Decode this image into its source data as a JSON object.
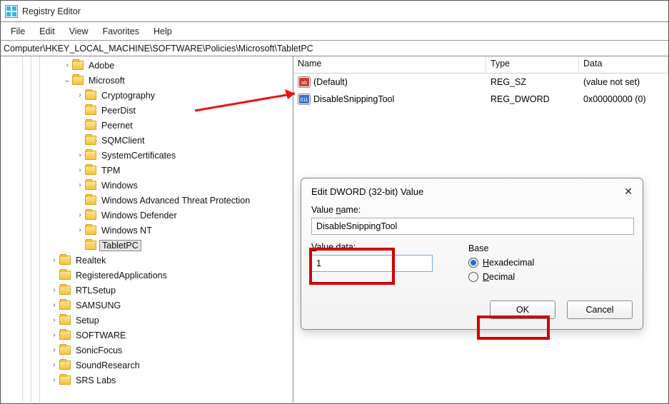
{
  "window": {
    "title": "Registry Editor"
  },
  "menu": {
    "file": "File",
    "edit": "Edit",
    "view": "View",
    "favorites": "Favorites",
    "help": "Help"
  },
  "address": {
    "path": "Computer\\HKEY_LOCAL_MACHINE\\SOFTWARE\\Policies\\Microsoft\\TabletPC"
  },
  "tree": {
    "items": [
      {
        "label": "Adobe",
        "indent": 1,
        "chev": "right"
      },
      {
        "label": "Microsoft",
        "indent": 1,
        "chev": "down"
      },
      {
        "label": "Cryptography",
        "indent": 2,
        "chev": "right"
      },
      {
        "label": "PeerDist",
        "indent": 2,
        "chev": ""
      },
      {
        "label": "Peernet",
        "indent": 2,
        "chev": ""
      },
      {
        "label": "SQMClient",
        "indent": 2,
        "chev": ""
      },
      {
        "label": "SystemCertificates",
        "indent": 2,
        "chev": "right"
      },
      {
        "label": "TPM",
        "indent": 2,
        "chev": "right"
      },
      {
        "label": "Windows",
        "indent": 2,
        "chev": "right"
      },
      {
        "label": "Windows Advanced Threat Protection",
        "indent": 2,
        "chev": ""
      },
      {
        "label": "Windows Defender",
        "indent": 2,
        "chev": "right"
      },
      {
        "label": "Windows NT",
        "indent": 2,
        "chev": "right"
      },
      {
        "label": "TabletPC",
        "indent": 2,
        "chev": "",
        "selected": true
      },
      {
        "label": "Realtek",
        "indent": 0,
        "chev": "right"
      },
      {
        "label": "RegisteredApplications",
        "indent": 0,
        "chev": ""
      },
      {
        "label": "RTLSetup",
        "indent": 0,
        "chev": "right"
      },
      {
        "label": "SAMSUNG",
        "indent": 0,
        "chev": "right"
      },
      {
        "label": "Setup",
        "indent": 0,
        "chev": "right"
      },
      {
        "label": "SOFTWARE",
        "indent": 0,
        "chev": "right"
      },
      {
        "label": "SonicFocus",
        "indent": 0,
        "chev": "right"
      },
      {
        "label": "SoundResearch",
        "indent": 0,
        "chev": "right"
      },
      {
        "label": "SRS Labs",
        "indent": 0,
        "chev": "right"
      }
    ]
  },
  "columns": {
    "name": "Name",
    "type": "Type",
    "data": "Data"
  },
  "values": [
    {
      "name": "(Default)",
      "type": "REG_SZ",
      "data": "(value not set)",
      "iconcolor": "#d43a2a",
      "iconglyph": "ab"
    },
    {
      "name": "DisableSnippingTool",
      "type": "REG_DWORD",
      "data": "0x00000000 (0)",
      "iconcolor": "#3a6fd4",
      "iconglyph": "011"
    }
  ],
  "dialog": {
    "title": "Edit DWORD (32-bit) Value",
    "value_name_label": "Value name:",
    "value_name": "DisableSnippingTool",
    "value_data_label": "Value data:",
    "value_data": "1",
    "base_label": "Base",
    "hex_label": "Hexadecimal",
    "dec_label": "Decimal",
    "ok": "OK",
    "cancel": "Cancel"
  }
}
